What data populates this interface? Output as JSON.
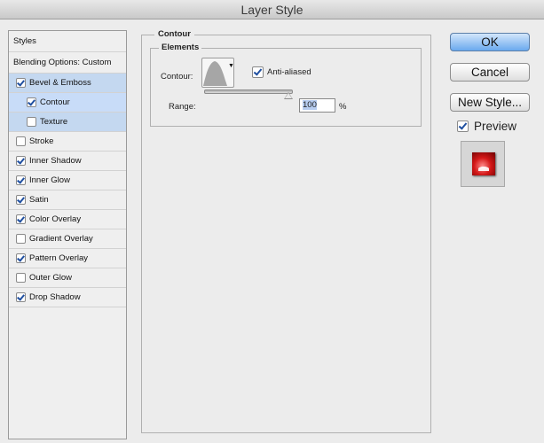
{
  "window": {
    "title": "Layer Style"
  },
  "styles_list": {
    "header": "Styles",
    "blending": "Blending Options: Custom",
    "items": [
      {
        "label": "Bevel & Emboss",
        "checked": true
      },
      {
        "label": "Contour",
        "checked": true
      },
      {
        "label": "Texture",
        "checked": false
      },
      {
        "label": "Stroke",
        "checked": false
      },
      {
        "label": "Inner Shadow",
        "checked": true
      },
      {
        "label": "Inner Glow",
        "checked": true
      },
      {
        "label": "Satin",
        "checked": true
      },
      {
        "label": "Color Overlay",
        "checked": true
      },
      {
        "label": "Gradient Overlay",
        "checked": false
      },
      {
        "label": "Pattern Overlay",
        "checked": true
      },
      {
        "label": "Outer Glow",
        "checked": false
      },
      {
        "label": "Drop Shadow",
        "checked": true
      }
    ]
  },
  "contour_panel": {
    "section_title": "Contour",
    "group_title": "Elements",
    "contour_label": "Contour:",
    "anti_aliased_label": "Anti-aliased",
    "anti_aliased_checked": true,
    "range_label": "Range:",
    "range_value": "100",
    "range_unit": "%",
    "range_fraction": 1.0
  },
  "buttons": {
    "ok": "OK",
    "cancel": "Cancel",
    "new_style": "New Style..."
  },
  "preview": {
    "label": "Preview",
    "checked": true
  },
  "colors": {
    "accent": "#6aa9ee",
    "selection": "#c4d8f0",
    "swatch": "#d41818"
  },
  "icons": {
    "contour_curve": "contour-curve-icon",
    "dropdown": "chevron-down-icon"
  }
}
